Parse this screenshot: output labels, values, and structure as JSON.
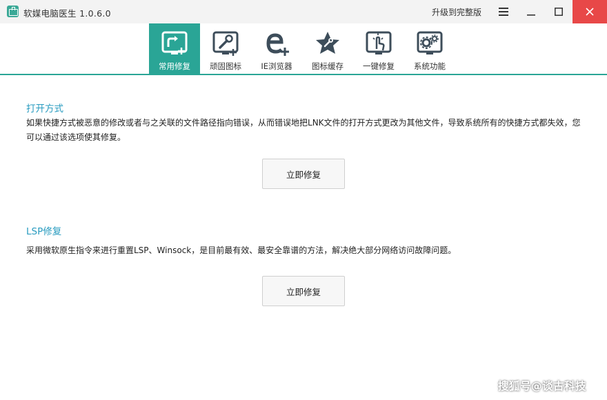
{
  "window": {
    "title": "软媒电脑医生 1.0.6.0",
    "upgrade_label": "升级到完整版"
  },
  "icons": {
    "app": "app-logo-icon",
    "menu": "hamburger-menu-icon",
    "minimize": "minimize-icon",
    "maximize": "maximize-icon",
    "close": "close-icon"
  },
  "colors": {
    "accent": "#2aa596",
    "section_title": "#2a9cc0",
    "close_button": "#e84848",
    "icon_dark": "#3d4d5a"
  },
  "tabs": [
    {
      "label": "常用修复",
      "icon": "shortcut-fix-icon",
      "active": true
    },
    {
      "label": "顽固图标",
      "icon": "stubborn-icon-tool-icon",
      "active": false
    },
    {
      "label": "IE浏览器",
      "icon": "ie-browser-icon",
      "active": false
    },
    {
      "label": "图标缓存",
      "icon": "icon-cache-star-icon",
      "active": false
    },
    {
      "label": "一键修复",
      "icon": "one-click-repair-icon",
      "active": false
    },
    {
      "label": "系统功能",
      "icon": "system-gears-icon",
      "active": false
    }
  ],
  "sections": [
    {
      "title": "打开方式",
      "desc_line1": "如果快捷方式被恶意的修改或者与之关联的文件路径指向错误，从而错误地把LNK文件的打开方式更改为其他文件，导致系统所有的快捷方式都失效，您",
      "desc_line2": "可以通过该选项使其修复。",
      "button": "立即修复"
    },
    {
      "title": "LSP修复",
      "desc_line1": "采用微软原生指令来进行重置LSP、Winsock，是目前最有效、最安全靠谱的方法，解决绝大部分网络访问故障问题。",
      "button": "立即修复"
    }
  ],
  "watermark": "搜狐号@谈古科技"
}
